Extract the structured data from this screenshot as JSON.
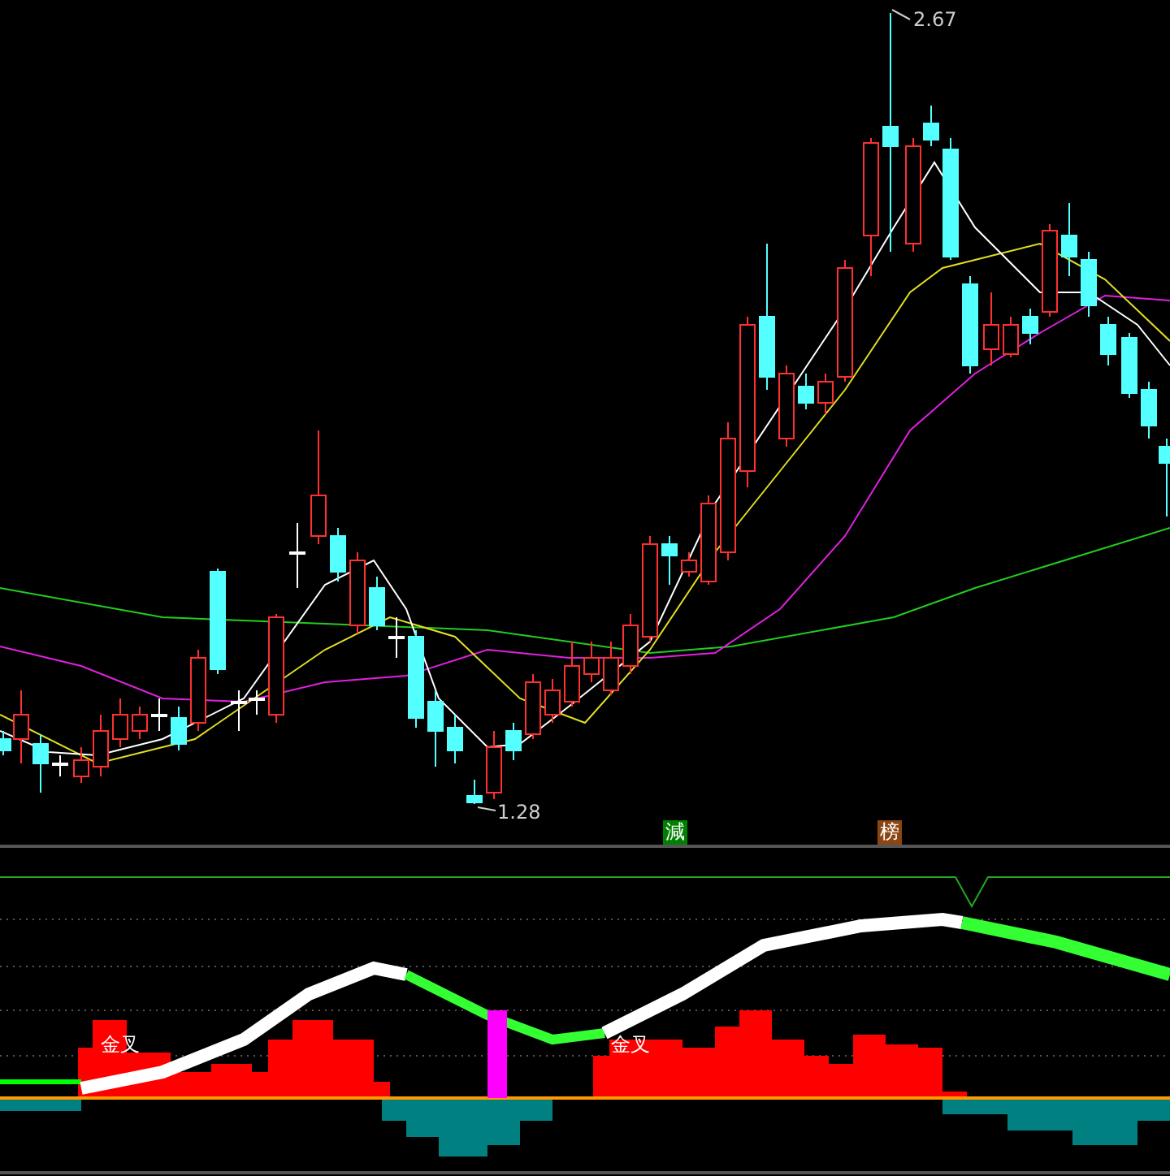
{
  "price_panel": {
    "high_label": "2.67",
    "low_label": "1.28"
  },
  "signals": [
    {
      "text": "減",
      "color": "#008000"
    },
    {
      "text": "榜",
      "color": "#8b4513"
    }
  ],
  "indicator_panel": {
    "cross_labels": [
      {
        "text": "金叉"
      },
      {
        "text": "金叉"
      }
    ]
  }
}
